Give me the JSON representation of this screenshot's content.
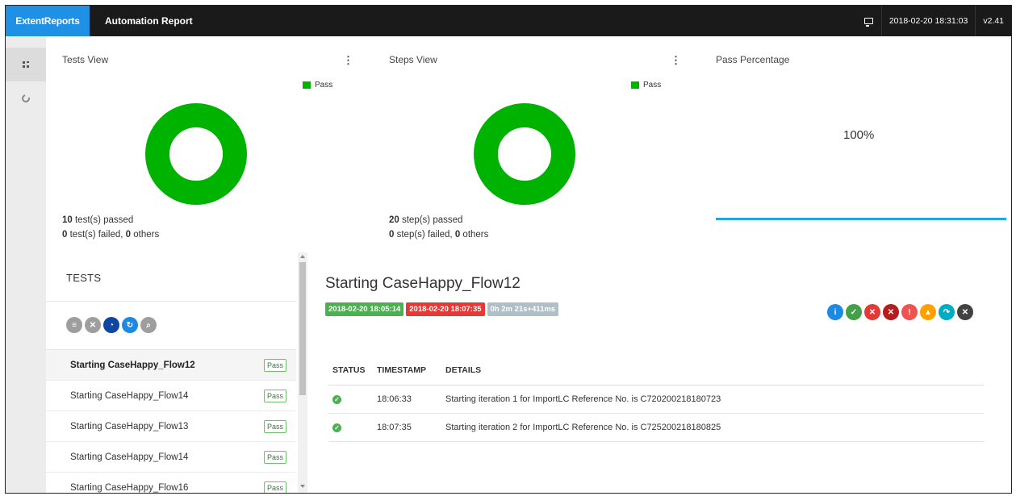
{
  "topbar": {
    "brand": "ExtentReports",
    "report_title": "Automation Report",
    "datetime": "2018-02-20 18:31:03",
    "version": "v2.41"
  },
  "dashboard": {
    "tests_view": {
      "title": "Tests View",
      "legend": "Pass",
      "passed_count": "10",
      "passed_suffix": " test(s) passed",
      "failed_count": "0",
      "failed_mid": " test(s) failed, ",
      "others_count": "0",
      "others_suffix": " others"
    },
    "steps_view": {
      "title": "Steps View",
      "legend": "Pass",
      "passed_count": "20",
      "passed_suffix": " step(s) passed",
      "failed_count": "0",
      "failed_mid": " step(s) failed, ",
      "others_count": "0",
      "others_suffix": " others"
    },
    "pass_percentage": {
      "title": "Pass Percentage",
      "value": "100%"
    },
    "pass_color": "#00b300"
  },
  "tests_panel": {
    "header": "TESTS",
    "items": [
      {
        "name": "Starting CaseHappy_Flow12",
        "status": "Pass"
      },
      {
        "name": "Starting CaseHappy_Flow14",
        "status": "Pass"
      },
      {
        "name": "Starting CaseHappy_Flow13",
        "status": "Pass"
      },
      {
        "name": "Starting CaseHappy_Flow14",
        "status": "Pass"
      },
      {
        "name": "Starting CaseHappy_Flow16",
        "status": "Pass"
      }
    ]
  },
  "detail": {
    "title": "Starting CaseHappy_Flow12",
    "start_time": "2018-02-20 18:05:14",
    "end_time": "2018-02-20 18:07:35",
    "duration": "0h 2m 21s+411ms",
    "columns": [
      "STATUS",
      "TIMESTAMP",
      "DETAILS"
    ],
    "logs": [
      {
        "timestamp": "18:06:33",
        "details": "Starting iteration 1 for ImportLC Reference No. is C720200218180723"
      },
      {
        "timestamp": "18:07:35",
        "details": "Starting iteration 2 for ImportLC Reference No. is C725200218180825"
      }
    ]
  }
}
